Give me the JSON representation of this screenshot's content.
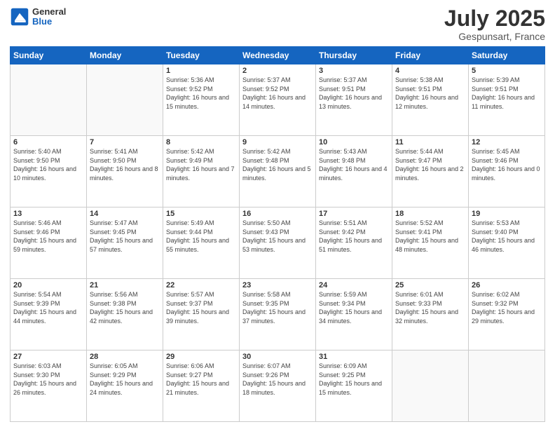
{
  "header": {
    "logo_general": "General",
    "logo_blue": "Blue",
    "month_title": "July 2025",
    "location": "Gespunsart, France"
  },
  "weekdays": [
    "Sunday",
    "Monday",
    "Tuesday",
    "Wednesday",
    "Thursday",
    "Friday",
    "Saturday"
  ],
  "weeks": [
    [
      {
        "day": "",
        "info": ""
      },
      {
        "day": "",
        "info": ""
      },
      {
        "day": "1",
        "info": "Sunrise: 5:36 AM\nSunset: 9:52 PM\nDaylight: 16 hours and 15 minutes."
      },
      {
        "day": "2",
        "info": "Sunrise: 5:37 AM\nSunset: 9:52 PM\nDaylight: 16 hours and 14 minutes."
      },
      {
        "day": "3",
        "info": "Sunrise: 5:37 AM\nSunset: 9:51 PM\nDaylight: 16 hours and 13 minutes."
      },
      {
        "day": "4",
        "info": "Sunrise: 5:38 AM\nSunset: 9:51 PM\nDaylight: 16 hours and 12 minutes."
      },
      {
        "day": "5",
        "info": "Sunrise: 5:39 AM\nSunset: 9:51 PM\nDaylight: 16 hours and 11 minutes."
      }
    ],
    [
      {
        "day": "6",
        "info": "Sunrise: 5:40 AM\nSunset: 9:50 PM\nDaylight: 16 hours and 10 minutes."
      },
      {
        "day": "7",
        "info": "Sunrise: 5:41 AM\nSunset: 9:50 PM\nDaylight: 16 hours and 8 minutes."
      },
      {
        "day": "8",
        "info": "Sunrise: 5:42 AM\nSunset: 9:49 PM\nDaylight: 16 hours and 7 minutes."
      },
      {
        "day": "9",
        "info": "Sunrise: 5:42 AM\nSunset: 9:48 PM\nDaylight: 16 hours and 5 minutes."
      },
      {
        "day": "10",
        "info": "Sunrise: 5:43 AM\nSunset: 9:48 PM\nDaylight: 16 hours and 4 minutes."
      },
      {
        "day": "11",
        "info": "Sunrise: 5:44 AM\nSunset: 9:47 PM\nDaylight: 16 hours and 2 minutes."
      },
      {
        "day": "12",
        "info": "Sunrise: 5:45 AM\nSunset: 9:46 PM\nDaylight: 16 hours and 0 minutes."
      }
    ],
    [
      {
        "day": "13",
        "info": "Sunrise: 5:46 AM\nSunset: 9:46 PM\nDaylight: 15 hours and 59 minutes."
      },
      {
        "day": "14",
        "info": "Sunrise: 5:47 AM\nSunset: 9:45 PM\nDaylight: 15 hours and 57 minutes."
      },
      {
        "day": "15",
        "info": "Sunrise: 5:49 AM\nSunset: 9:44 PM\nDaylight: 15 hours and 55 minutes."
      },
      {
        "day": "16",
        "info": "Sunrise: 5:50 AM\nSunset: 9:43 PM\nDaylight: 15 hours and 53 minutes."
      },
      {
        "day": "17",
        "info": "Sunrise: 5:51 AM\nSunset: 9:42 PM\nDaylight: 15 hours and 51 minutes."
      },
      {
        "day": "18",
        "info": "Sunrise: 5:52 AM\nSunset: 9:41 PM\nDaylight: 15 hours and 48 minutes."
      },
      {
        "day": "19",
        "info": "Sunrise: 5:53 AM\nSunset: 9:40 PM\nDaylight: 15 hours and 46 minutes."
      }
    ],
    [
      {
        "day": "20",
        "info": "Sunrise: 5:54 AM\nSunset: 9:39 PM\nDaylight: 15 hours and 44 minutes."
      },
      {
        "day": "21",
        "info": "Sunrise: 5:56 AM\nSunset: 9:38 PM\nDaylight: 15 hours and 42 minutes."
      },
      {
        "day": "22",
        "info": "Sunrise: 5:57 AM\nSunset: 9:37 PM\nDaylight: 15 hours and 39 minutes."
      },
      {
        "day": "23",
        "info": "Sunrise: 5:58 AM\nSunset: 9:35 PM\nDaylight: 15 hours and 37 minutes."
      },
      {
        "day": "24",
        "info": "Sunrise: 5:59 AM\nSunset: 9:34 PM\nDaylight: 15 hours and 34 minutes."
      },
      {
        "day": "25",
        "info": "Sunrise: 6:01 AM\nSunset: 9:33 PM\nDaylight: 15 hours and 32 minutes."
      },
      {
        "day": "26",
        "info": "Sunrise: 6:02 AM\nSunset: 9:32 PM\nDaylight: 15 hours and 29 minutes."
      }
    ],
    [
      {
        "day": "27",
        "info": "Sunrise: 6:03 AM\nSunset: 9:30 PM\nDaylight: 15 hours and 26 minutes."
      },
      {
        "day": "28",
        "info": "Sunrise: 6:05 AM\nSunset: 9:29 PM\nDaylight: 15 hours and 24 minutes."
      },
      {
        "day": "29",
        "info": "Sunrise: 6:06 AM\nSunset: 9:27 PM\nDaylight: 15 hours and 21 minutes."
      },
      {
        "day": "30",
        "info": "Sunrise: 6:07 AM\nSunset: 9:26 PM\nDaylight: 15 hours and 18 minutes."
      },
      {
        "day": "31",
        "info": "Sunrise: 6:09 AM\nSunset: 9:25 PM\nDaylight: 15 hours and 15 minutes."
      },
      {
        "day": "",
        "info": ""
      },
      {
        "day": "",
        "info": ""
      }
    ]
  ]
}
